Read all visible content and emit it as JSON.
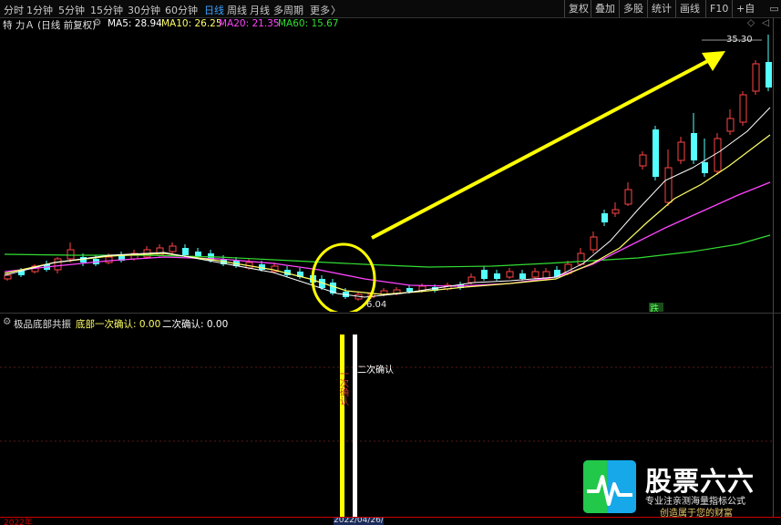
{
  "toolbar": {
    "timeframes": [
      "分时",
      "1分钟",
      "5分钟",
      "15分钟",
      "30分钟",
      "60分钟",
      "日线",
      "周线",
      "月线",
      "多周期",
      "更多"
    ],
    "more_arrow": "〉",
    "active": "日线",
    "right_buttons": [
      "复权",
      "叠加",
      "多股",
      "统计",
      "画线",
      "F10",
      "+自"
    ]
  },
  "info": {
    "stock": "特 力Ａ (日线 前复权)",
    "ma5": "MA5: 28.94",
    "ma10": "MA10: 26.25",
    "ma20": "MA20: 21.35",
    "ma60": "MA60: 15.67",
    "icons": [
      "◇",
      "◁"
    ]
  },
  "main_chart": {
    "high_label": "35.30",
    "low_label": "6.04",
    "badge": "跌"
  },
  "indicator": {
    "name": "极品底部共振",
    "first_label": "底部一次确认: 0.00",
    "second_label": "二次确认: 0.00",
    "annot_first": "一次确认",
    "annot_second": "二次确认"
  },
  "bottom_axis": {
    "left": "2022年",
    "date": "2022/04/26/"
  },
  "watermark": {
    "title": "股票六六",
    "line1": "专业注亲测海量指标公式",
    "line2": "创造属于您的财富"
  },
  "colors": {
    "up": "#ff4444",
    "down": "#54ffff",
    "ma5": "#ffffff",
    "ma10": "#ffff66",
    "ma20": "#ff44ff",
    "ma60": "#33dd33",
    "arrow": "#ffff00",
    "active_tab": "#3aa0ff"
  }
}
